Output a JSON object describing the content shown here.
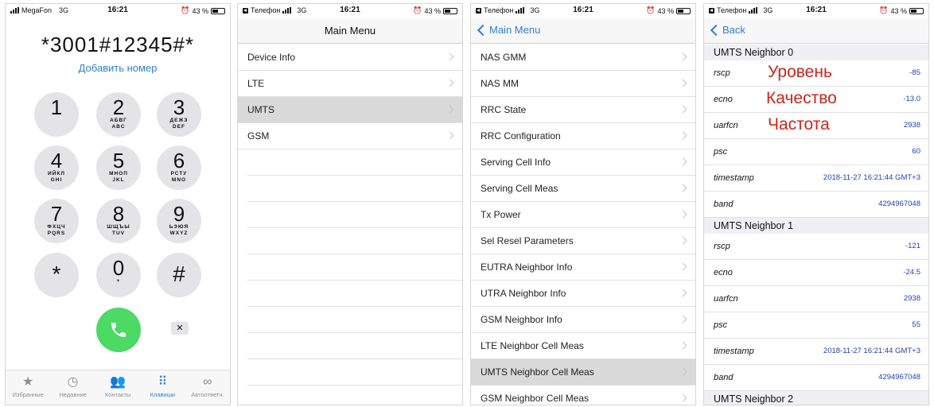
{
  "dialer": {
    "carrier": "MegaFon",
    "network": "3G",
    "time": "16:21",
    "battery": "43 %",
    "battery_level": 0.43,
    "number": "*3001#12345#*",
    "add_number": "Добавить номер",
    "keys": [
      {
        "digit": "1",
        "letters": ""
      },
      {
        "digit": "2",
        "letters": "АБВГ ABC"
      },
      {
        "digit": "3",
        "letters": "ДЕЖЗ DEF"
      },
      {
        "digit": "4",
        "letters": "ИЙКЛ GHI"
      },
      {
        "digit": "5",
        "letters": "МНОП JKL"
      },
      {
        "digit": "6",
        "letters": "РСТУ MNO"
      },
      {
        "digit": "7",
        "letters": "ФХЦЧ PQRS"
      },
      {
        "digit": "8",
        "letters": "ШЩЪЫ TUV"
      },
      {
        "digit": "9",
        "letters": "ЬЭЮЯ WXYZ"
      },
      {
        "digit": "*",
        "letters": ""
      },
      {
        "digit": "0",
        "letters": "+"
      },
      {
        "digit": "#",
        "letters": ""
      }
    ],
    "tabs": [
      {
        "label": "Избранные",
        "icon": "star-icon"
      },
      {
        "label": "Недавние",
        "icon": "clock-icon"
      },
      {
        "label": "Контакты",
        "icon": "contacts-icon"
      },
      {
        "label": "Клавиши",
        "icon": "keypad-icon"
      },
      {
        "label": "Автоответч.",
        "icon": "voicemail-icon"
      }
    ]
  },
  "menu": {
    "back_app": "Телефон",
    "network": "3G",
    "time": "16:21",
    "battery": "43 %",
    "title": "Main Menu",
    "items": [
      "Device Info",
      "LTE",
      "UMTS",
      "GSM"
    ],
    "selected": "UMTS"
  },
  "umts": {
    "back_app": "Телефон",
    "network": "3G",
    "time": "16:21",
    "battery": "43 %",
    "back_label": "Main Menu",
    "items": [
      "NAS GMM",
      "NAS MM",
      "RRC State",
      "RRC Configuration",
      "Serving Cell Info",
      "Serving Cell Meas",
      "Tx Power",
      "Sel Resel Parameters",
      "EUTRA Neighbor Info",
      "UTRA Neighbor Info",
      "GSM Neighbor Info",
      "LTE Neighbor Cell Meas",
      "UMTS Neighbor Cell Meas",
      "GSM Neighbor Cell Meas"
    ],
    "selected": "UMTS Neighbor Cell Meas"
  },
  "neighbor": {
    "back_app": "Телефон",
    "network": "3G",
    "time": "16:21",
    "battery": "43 %",
    "back_label": "Back",
    "sections": [
      {
        "title": "UMTS Neighbor 0",
        "rows": [
          {
            "key": "rscp",
            "value": "-85"
          },
          {
            "key": "ecno",
            "value": "-13.0"
          },
          {
            "key": "uarfcn",
            "value": "2938"
          },
          {
            "key": "psc",
            "value": "60"
          },
          {
            "key": "timestamp",
            "value": "2018-11-27 16:21:44 GMT+3"
          },
          {
            "key": "band",
            "value": "4294967048"
          }
        ]
      },
      {
        "title": "UMTS Neighbor 1",
        "rows": [
          {
            "key": "rscp",
            "value": "-121"
          },
          {
            "key": "ecno",
            "value": "-24.5"
          },
          {
            "key": "uarfcn",
            "value": "2938"
          },
          {
            "key": "psc",
            "value": "55"
          },
          {
            "key": "timestamp",
            "value": "2018-11-27 16:21:44 GMT+3"
          },
          {
            "key": "band",
            "value": "4294967048"
          }
        ]
      },
      {
        "title": "UMTS Neighbor 2",
        "rows": []
      }
    ],
    "annotations": [
      "Уровень",
      "Качество",
      "Частота"
    ],
    "annotation_color": "#d0231a"
  },
  "colors": {
    "accent": "#2f7fd6",
    "call_green": "#4cd964",
    "value_blue": "#1e3fb6"
  }
}
